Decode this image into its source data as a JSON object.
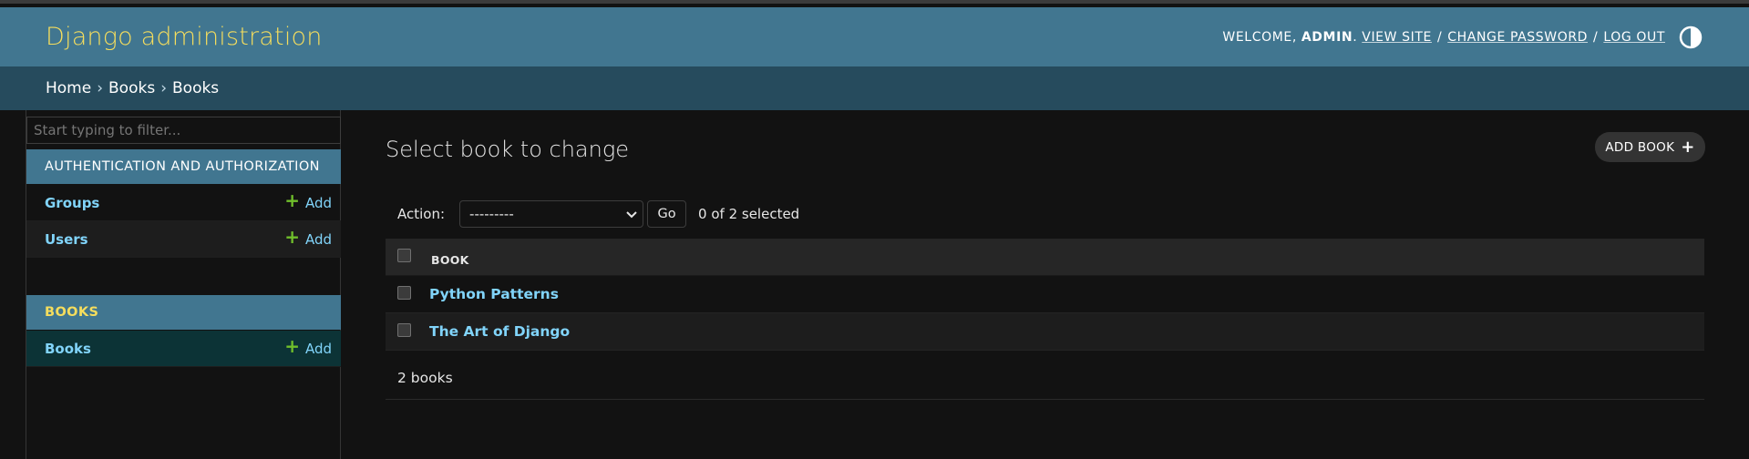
{
  "header": {
    "site_name": "Django administration",
    "welcome": "Welcome,",
    "username": "admin",
    "view_site": "View site",
    "change_password": "Change password",
    "log_out": "Log out",
    "separator": "/"
  },
  "breadcrumbs": {
    "home": "Home",
    "app": "Books",
    "model": "Books",
    "separator": "›"
  },
  "sidebar": {
    "filter_placeholder": "Start typing to filter...",
    "modules": [
      {
        "caption": "Authentication and Authorization",
        "models": [
          {
            "name": "Groups",
            "add": "Add"
          },
          {
            "name": "Users",
            "add": "Add"
          }
        ]
      },
      {
        "caption": "Books",
        "models": [
          {
            "name": "Books",
            "add": "Add"
          }
        ]
      }
    ]
  },
  "content": {
    "title": "Select book to change",
    "add_button": "Add book",
    "action_label": "Action:",
    "action_selected": "---------",
    "go_button": "Go",
    "selection_counter": "0 of 2 selected",
    "column_header": "Book",
    "rows": [
      "Python Patterns",
      "The Art of Django"
    ],
    "paginator": "2 books"
  },
  "colors": {
    "header_bg": "#417690",
    "breadcrumbs_bg": "#264b5d",
    "site_name": "#f5dd5d",
    "link": "#81d4fa",
    "add_plus": "#70bf2b",
    "page_bg": "#121212"
  },
  "icons": {
    "theme_toggle": "half-circle-icon",
    "add": "plus-icon",
    "select_arrow": "chevron-down-icon"
  }
}
